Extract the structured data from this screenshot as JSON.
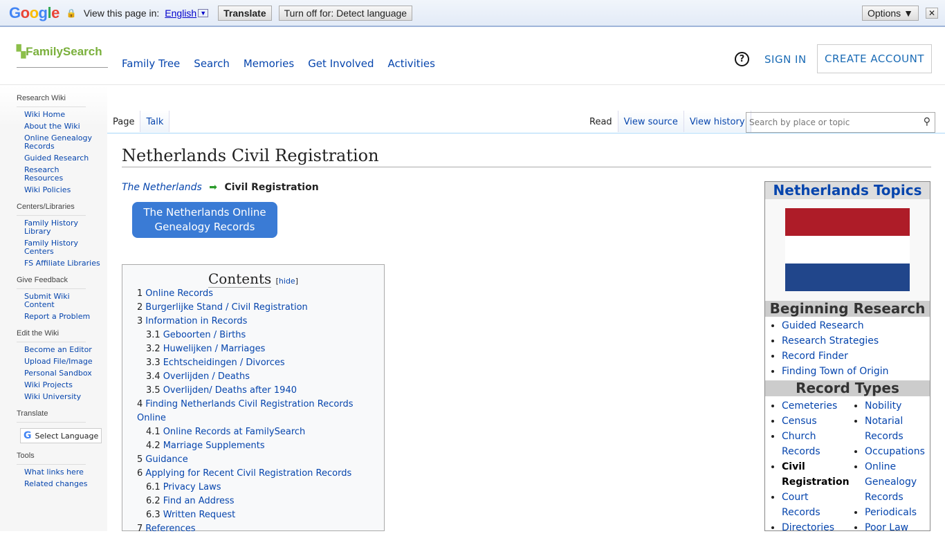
{
  "translate_bar": {
    "brand": "Google",
    "prompt": "View this page in:",
    "language": "English",
    "translate": "Translate",
    "turn_off": "Turn off for: Detect language",
    "options": "Options ▼",
    "close": "✕"
  },
  "header": {
    "logo": "FamilySearch",
    "nav": [
      "Family Tree",
      "Search",
      "Memories",
      "Get Involved",
      "Activities"
    ],
    "help": "?",
    "sign_in": "SIGN IN",
    "create_account": "CREATE ACCOUNT"
  },
  "sidebar": [
    {
      "heading": "Research Wiki",
      "links": [
        "Wiki Home",
        "About the Wiki",
        "Online Genealogy Records",
        "Guided Research",
        "Research Resources",
        "Wiki Policies"
      ]
    },
    {
      "heading": "Centers/Libraries",
      "links": [
        "Family History Library",
        "Family History Centers",
        "FS Affiliate Libraries"
      ]
    },
    {
      "heading": "Give Feedback",
      "links": [
        "Submit Wiki Content",
        "Report a Problem"
      ]
    },
    {
      "heading": "Edit the Wiki",
      "links": [
        "Become an Editor",
        "Upload File/Image",
        "Personal Sandbox",
        "Wiki Projects",
        "Wiki University"
      ]
    },
    {
      "heading": "Translate",
      "links": []
    },
    {
      "heading": "Tools",
      "links": [
        "What links here",
        "Related changes"
      ]
    }
  ],
  "select_language": "Select Language",
  "tabs": {
    "left": [
      "Page",
      "Talk"
    ],
    "right": [
      "Read",
      "View source",
      "View history"
    ]
  },
  "search": {
    "placeholder": "Search by place or topic"
  },
  "title": "Netherlands Civil Registration",
  "breadcrumb": {
    "parent": "The Netherlands",
    "arrow": "➡",
    "current": "Civil Registration"
  },
  "online_button": "The Netherlands Online Genealogy Records",
  "toc": {
    "title": "Contents",
    "hide": "hide",
    "items": [
      {
        "n": "1",
        "t": "Online Records",
        "s": false
      },
      {
        "n": "2",
        "t": "Burgerlijke Stand / Civil Registration",
        "s": false
      },
      {
        "n": "3",
        "t": "Information in Records",
        "s": false
      },
      {
        "n": "3.1",
        "t": "Geboorten / Births",
        "s": true
      },
      {
        "n": "3.2",
        "t": "Huwelijken / Marriages",
        "s": true
      },
      {
        "n": "3.3",
        "t": "Echtscheidingen / Divorces",
        "s": true
      },
      {
        "n": "3.4",
        "t": "Overlijden / Deaths",
        "s": true
      },
      {
        "n": "3.5",
        "t": "Overlijden/ Deaths after 1940",
        "s": true
      },
      {
        "n": "4",
        "t": "Finding Netherlands Civil Registration Records Online",
        "s": false
      },
      {
        "n": "4.1",
        "t": "Online Records at FamilySearch",
        "s": true
      },
      {
        "n": "4.2",
        "t": "Marriage Supplements",
        "s": true
      },
      {
        "n": "5",
        "t": "Guidance",
        "s": false
      },
      {
        "n": "6",
        "t": "Applying for Recent Civil Registration Records",
        "s": false
      },
      {
        "n": "6.1",
        "t": "Privacy Laws",
        "s": true
      },
      {
        "n": "6.2",
        "t": "Find an Address",
        "s": true
      },
      {
        "n": "6.3",
        "t": "Written Request",
        "s": true
      },
      {
        "n": "7",
        "t": "References",
        "s": false
      }
    ]
  },
  "infobox": {
    "title": "Netherlands Topics",
    "flag_colors": [
      "#ae1c28",
      "#ffffff",
      "#21468b"
    ],
    "beginning": "Beginning Research",
    "beginning_links": [
      "Guided Research",
      "Research Strategies",
      "Record Finder",
      "Finding Town of Origin"
    ],
    "record_types": "Record Types",
    "col1": [
      "Cemeteries",
      "Census",
      "Church Records",
      "Civil Registration",
      "Court Records",
      "Directories"
    ],
    "col2": [
      "Nobility",
      "Notarial Records",
      "Occupations",
      "Online Genealogy Records",
      "Periodicals",
      "Poor Law"
    ],
    "current": "Civil Registration"
  }
}
